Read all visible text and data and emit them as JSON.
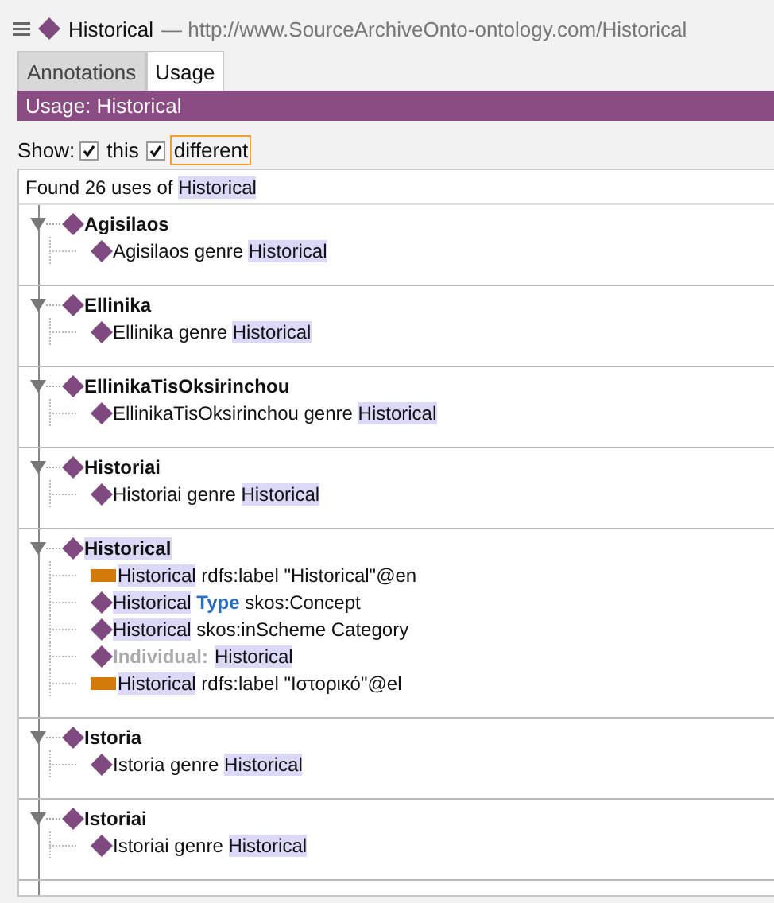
{
  "header": {
    "entity": "Historical",
    "separator": "—",
    "iri": "http://www.SourceArchiveOnto-ontology.com/Historical"
  },
  "tabs": [
    {
      "label": "Annotations",
      "selected": false
    },
    {
      "label": "Usage",
      "selected": true
    }
  ],
  "panel_title": "Usage: Historical",
  "show": {
    "label": "Show:",
    "options": [
      {
        "label": "this",
        "checked": true,
        "focused": false
      },
      {
        "label": "different",
        "checked": true,
        "focused": true
      }
    ]
  },
  "summary": [
    {
      "kind": "plain",
      "text": "Found 26 uses of "
    },
    {
      "kind": "highlight",
      "text": "Historical"
    }
  ],
  "groups": [
    {
      "name": "Agisilaos",
      "highlighted": false,
      "expanded": true,
      "children": [
        {
          "kind": "individual",
          "segments": [
            {
              "kind": "plain",
              "text": "Agisilaos genre "
            },
            {
              "kind": "highlight",
              "text": "Historical"
            }
          ]
        }
      ]
    },
    {
      "name": "Ellinika",
      "highlighted": false,
      "expanded": true,
      "children": [
        {
          "kind": "individual",
          "segments": [
            {
              "kind": "plain",
              "text": "Ellinika genre "
            },
            {
              "kind": "highlight",
              "text": "Historical"
            }
          ]
        }
      ]
    },
    {
      "name": "EllinikaTisOksirinchou",
      "highlighted": false,
      "expanded": true,
      "children": [
        {
          "kind": "individual",
          "segments": [
            {
              "kind": "plain",
              "text": "EllinikaTisOksirinchou genre "
            },
            {
              "kind": "highlight",
              "text": "Historical"
            }
          ]
        }
      ]
    },
    {
      "name": "Historiai",
      "highlighted": false,
      "expanded": true,
      "children": [
        {
          "kind": "individual",
          "segments": [
            {
              "kind": "plain",
              "text": "Historiai genre "
            },
            {
              "kind": "highlight",
              "text": "Historical"
            }
          ]
        }
      ]
    },
    {
      "name": "Historical",
      "highlighted": true,
      "expanded": true,
      "children": [
        {
          "kind": "annotation",
          "segments": [
            {
              "kind": "highlight",
              "text": "Historical"
            },
            {
              "kind": "plain",
              "text": " rdfs:label \"Historical\"@en"
            }
          ]
        },
        {
          "kind": "individual",
          "segments": [
            {
              "kind": "highlight",
              "text": "Historical"
            },
            {
              "kind": "keyword",
              "text": " Type"
            },
            {
              "kind": "plain",
              "text": " skos:Concept"
            }
          ]
        },
        {
          "kind": "individual",
          "segments": [
            {
              "kind": "highlight",
              "text": "Historical"
            },
            {
              "kind": "plain",
              "text": " skos:inScheme Category"
            }
          ]
        },
        {
          "kind": "individual",
          "segments": [
            {
              "kind": "muted",
              "text": "Individual:"
            },
            {
              "kind": "highlight",
              "text": "Historical"
            }
          ]
        },
        {
          "kind": "annotation",
          "segments": [
            {
              "kind": "highlight",
              "text": "Historical"
            },
            {
              "kind": "plain",
              "text": " rdfs:label \"Ιστορικό\"@el"
            }
          ]
        }
      ]
    },
    {
      "name": "Istoria",
      "highlighted": false,
      "expanded": true,
      "children": [
        {
          "kind": "individual",
          "segments": [
            {
              "kind": "plain",
              "text": "Istoria genre "
            },
            {
              "kind": "highlight",
              "text": "Historical"
            }
          ]
        }
      ]
    },
    {
      "name": "Istoriai",
      "highlighted": false,
      "expanded": true,
      "children": [
        {
          "kind": "individual",
          "segments": [
            {
              "kind": "plain",
              "text": "Istoriai genre "
            },
            {
              "kind": "highlight",
              "text": "Historical"
            }
          ]
        }
      ]
    }
  ]
}
